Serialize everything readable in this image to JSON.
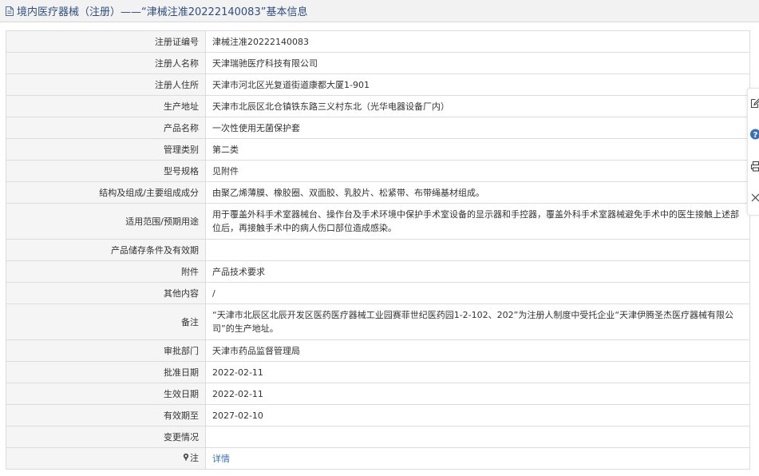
{
  "header": {
    "title": "境内医疗器械（注册）——“津械注准20222140083”基本信息"
  },
  "table": {
    "rows": [
      {
        "label": "注册证编号",
        "value": "津械注准20222140083"
      },
      {
        "label": "注册人名称",
        "value": "天津瑞驰医疗科技有限公司"
      },
      {
        "label": "注册人住所",
        "value": "天津市河北区光复道街道康都大厦1-901"
      },
      {
        "label": "生产地址",
        "value": "天津市北辰区北仓镇铁东路三义村东北（光华电器设备厂内）"
      },
      {
        "label": "产品名称",
        "value": "一次性使用无菌保护套"
      },
      {
        "label": "管理类别",
        "value": "第二类"
      },
      {
        "label": "型号规格",
        "value": "见附件"
      },
      {
        "label": "结构及组成/主要组成成分",
        "value": "由聚乙烯薄膜、橡胶圈、双面胶、乳胶片、松紧带、布带绳基材组成。"
      },
      {
        "label": "适用范围/预期用途",
        "value": "用于覆盖外科手术室器械台、操作台及手术环境中保护手术室设备的显示器和手控器，覆盖外科手术室器械避免手术中的医生接触上述部位后，再接触手术中的病人伤口部位造成感染。"
      },
      {
        "label": "产品储存条件及有效期",
        "value": ""
      },
      {
        "label": "附件",
        "value": "产品技术要求"
      },
      {
        "label": "其他内容",
        "value": "/"
      },
      {
        "label": "备注",
        "value": "“天津市北辰区北辰开发区医药医疗器械工业园赛菲世纪医药园1-2-102、202”为注册人制度中受托企业“天津伊腾圣杰医疗器械有限公司”的生产地址。"
      },
      {
        "label": "审批部门",
        "value": "天津市药品监督管理局"
      },
      {
        "label": "批准日期",
        "value": "2022-02-11"
      },
      {
        "label": "生效日期",
        "value": "2022-02-11"
      },
      {
        "label": "有效期至",
        "value": "2027-02-10"
      },
      {
        "label": "变更情况",
        "value": ""
      }
    ],
    "note_row": {
      "label": "注",
      "link": "详情"
    }
  },
  "icons": {
    "title": "document-icon",
    "pin": "pin-icon",
    "sidebar": [
      "edit-icon",
      "help-icon",
      "print-icon",
      "close-icon"
    ]
  },
  "colors": {
    "link": "#3a6fbf",
    "title": "#2f4f7f",
    "help": "#3b6fb6"
  }
}
